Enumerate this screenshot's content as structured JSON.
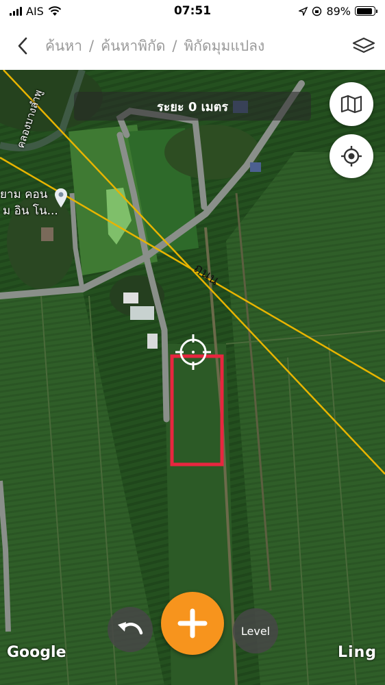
{
  "status_bar": {
    "carrier": "AIS",
    "time": "07:51",
    "battery_percent": "89%",
    "battery_level": 0.89,
    "icons": [
      "signal-icon",
      "wifi-icon",
      "location-arrow-icon",
      "orientation-lock-icon",
      "battery-icon"
    ]
  },
  "nav": {
    "back_icon": "chevron-left-icon",
    "breadcrumb": [
      "ค้นหา",
      "ค้นหาพิกัด",
      "พิกัดมุมแปลง"
    ],
    "separator": "/",
    "layers_icon": "layers-icon"
  },
  "map": {
    "distance_text": "ระยะ 0 เมตร",
    "map_type_icon": "map-icon",
    "locate_icon": "target-icon",
    "labels": {
      "canal": "คลองบางลำพู",
      "place_line1": "ยาม คอน",
      "place_line2": "ม อิน โน...",
      "road": "ถนน"
    },
    "google_label": "Google",
    "ling_label": "Ling",
    "colors": {
      "boundary_line": "#e8b400",
      "plot_outline": "#e8263f",
      "add_button": "#f7941d"
    }
  },
  "controls": {
    "undo_icon": "undo-icon",
    "add_icon": "plus-icon",
    "level_label": "Level"
  }
}
